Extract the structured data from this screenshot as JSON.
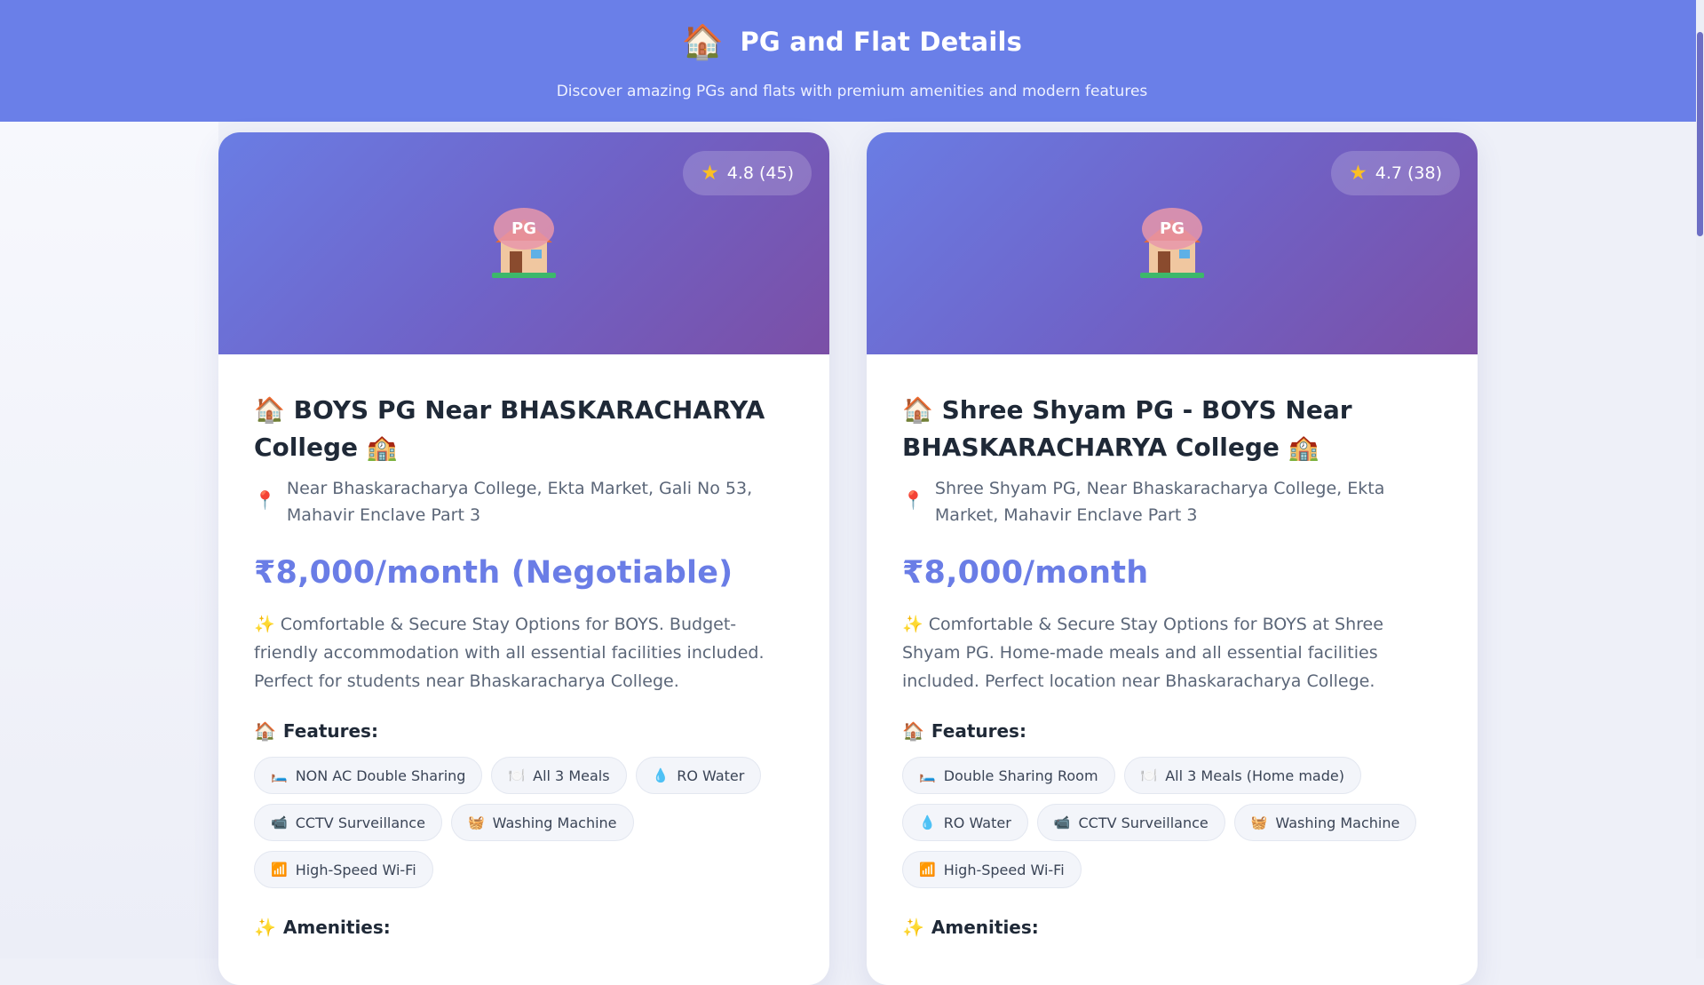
{
  "header": {
    "icon": "house-icon",
    "title": "PG and Flat Details",
    "subtitle": "Discover amazing PGs and flats with premium amenities and modern features"
  },
  "cards": [
    {
      "rating": "4.8 (45)",
      "badge": "PG",
      "title": "BOYS PG Near BHASKARACHARYA College",
      "address": "Near Bhaskaracharya College, Ekta Market, Gali No 53, Mahavir Enclave Part 3",
      "price": "₹8,000/month (Negotiable)",
      "description": "Comfortable & Secure Stay Options for BOYS. Budget-friendly accommodation with all essential facilities included. Perfect for students near Bhaskaracharya College.",
      "features_label": "Features:",
      "features": [
        {
          "icon": "bed-icon",
          "label": "NON AC Double Sharing"
        },
        {
          "icon": "plate-icon",
          "label": "All 3 Meals"
        },
        {
          "icon": "droplet-icon",
          "label": "RO Water"
        },
        {
          "icon": "camera-icon",
          "label": "CCTV Surveillance"
        },
        {
          "icon": "basket-icon",
          "label": "Washing Machine"
        },
        {
          "icon": "signal-icon",
          "label": "High-Speed Wi-Fi"
        }
      ],
      "amenities_label": "Amenities:"
    },
    {
      "rating": "4.7 (38)",
      "badge": "PG",
      "title": "Shree Shyam PG - BOYS Near BHASKARACHARYA College",
      "address": "Shree Shyam PG, Near Bhaskaracharya College, Ekta Market, Mahavir Enclave Part 3",
      "price": "₹8,000/month",
      "description": "Comfortable & Secure Stay Options for BOYS at Shree Shyam PG. Home-made meals and all essential facilities included. Perfect location near Bhaskaracharya College.",
      "features_label": "Features:",
      "features": [
        {
          "icon": "bed-icon",
          "label": "Double Sharing Room"
        },
        {
          "icon": "plate-icon",
          "label": "All 3 Meals (Home made)"
        },
        {
          "icon": "droplet-icon",
          "label": "RO Water"
        },
        {
          "icon": "camera-icon",
          "label": "CCTV Surveillance"
        },
        {
          "icon": "basket-icon",
          "label": "Washing Machine"
        },
        {
          "icon": "signal-icon",
          "label": "High-Speed Wi-Fi"
        }
      ],
      "amenities_label": "Amenities:"
    }
  ],
  "colors": {
    "header_bg": "#6a7fe8",
    "accent_price": "#6a7de6",
    "hero_gradient_start": "#6a7de4",
    "hero_gradient_end": "#7b4fa6"
  }
}
